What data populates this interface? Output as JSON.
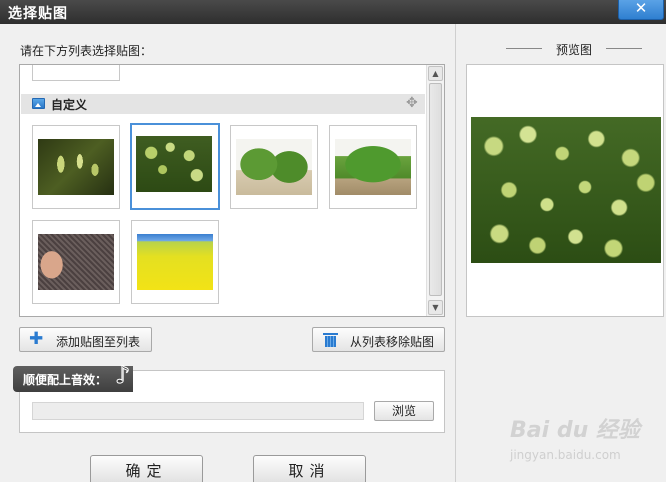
{
  "window": {
    "title": "选择贴图",
    "close_glyph": "✕"
  },
  "list": {
    "label": "请在下方列表选择贴图：",
    "group_name": "自定义",
    "items": [
      {
        "name": "honeysuckle-closeup",
        "selected": false
      },
      {
        "name": "honeysuckle-bush",
        "selected": true
      },
      {
        "name": "green-shrubs",
        "selected": false
      },
      {
        "name": "green-shrub-field",
        "selected": false
      },
      {
        "name": "hand-with-seeds",
        "selected": false
      },
      {
        "name": "rapeseed-field",
        "selected": false
      }
    ],
    "scroll_up_glyph": "▲",
    "scroll_down_glyph": "▼",
    "move_glyph": "✥"
  },
  "buttons": {
    "add_label": "添加贴图至列表",
    "remove_label": "从列表移除贴图",
    "ok_label": "确定",
    "cancel_label": "取消",
    "add_glyph": "✚"
  },
  "music": {
    "tab_label": "顺便配上音效：",
    "note_glyph": "♪",
    "file_value": "",
    "browse_label": "浏览"
  },
  "preview": {
    "title": "预览图"
  },
  "watermark": {
    "logo": "Bai du 经验",
    "url": "jingyan.baidu.com"
  },
  "icons": {
    "add": "plus-icon",
    "remove": "trash-icon",
    "group": "image-icon",
    "move": "move-icon",
    "music": "music-note-icon",
    "close": "close-icon"
  },
  "colors": {
    "accent": "#4a90d9",
    "titlebar": "#3a3a3a",
    "close": "#2f7fd0"
  }
}
